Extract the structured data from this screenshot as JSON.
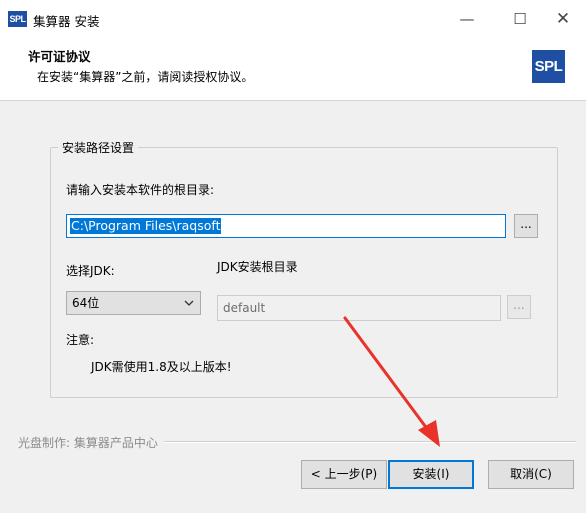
{
  "window": {
    "app_icon_text": "SPL",
    "title": "集算器 安装",
    "minimize_glyph": "—",
    "maximize_glyph": "☐",
    "close_glyph": "✕"
  },
  "header": {
    "title": "许可证协议",
    "subtitle": "在安装“集算器”之前，请阅读授权协议。",
    "logo_text": "SPL"
  },
  "group": {
    "label": "安装路径设置",
    "prompt": "请输入安装本软件的根目录:",
    "install_path": "C:\\Program Files\\raqsoft",
    "browse_label": "...",
    "jdk_label": "选择JDK:",
    "jdk_selected": "64位",
    "jdk_dir_label": "JDK安装根目录",
    "jdk_dir_value": "default",
    "jdk_browse_label": "...",
    "note_label": "注意:",
    "note_text": "JDK需使用1.8及以上版本!"
  },
  "footer": {
    "label": "光盘制作: 集算器产品中心",
    "back_label": "< 上一步(P)",
    "install_label": "安装(I)",
    "cancel_label": "取消(C)"
  },
  "colors": {
    "accent": "#0078d7",
    "logo_blue": "#1f4fa3",
    "arrow_red": "#e8322a"
  }
}
